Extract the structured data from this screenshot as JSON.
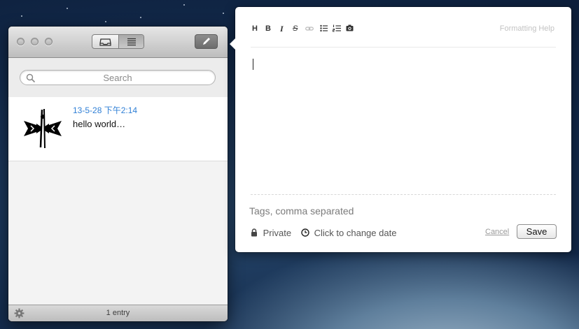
{
  "sidebar_window": {
    "search": {
      "placeholder": "Search"
    },
    "entries": [
      {
        "date": "13-5-28 下午2:14",
        "preview": "hello world…",
        "thumbnail_icon": "winged-glyph-thumbnail"
      }
    ],
    "footer": {
      "count_text": "1 entry",
      "settings_icon": "gear-icon"
    },
    "toolbar": {
      "view_icons": [
        "inbox-icon",
        "list-icon"
      ],
      "compose_icon": "pencil-icon"
    }
  },
  "editor": {
    "toolbar": {
      "heading": "H",
      "bold": "B",
      "italic": "I",
      "strikethrough": "S",
      "icons": [
        "link-icon",
        "bulleted-list-icon",
        "numbered-list-icon",
        "camera-icon"
      ]
    },
    "formatting_help": "Formatting Help",
    "tags_placeholder": "Tags, comma separated",
    "privacy_label": "Private",
    "date_label": "Click to change date",
    "cancel_label": "Cancel",
    "save_label": "Save"
  },
  "colors": {
    "accent_date": "#2f7fd6",
    "desktop_dark": "#12294a"
  }
}
